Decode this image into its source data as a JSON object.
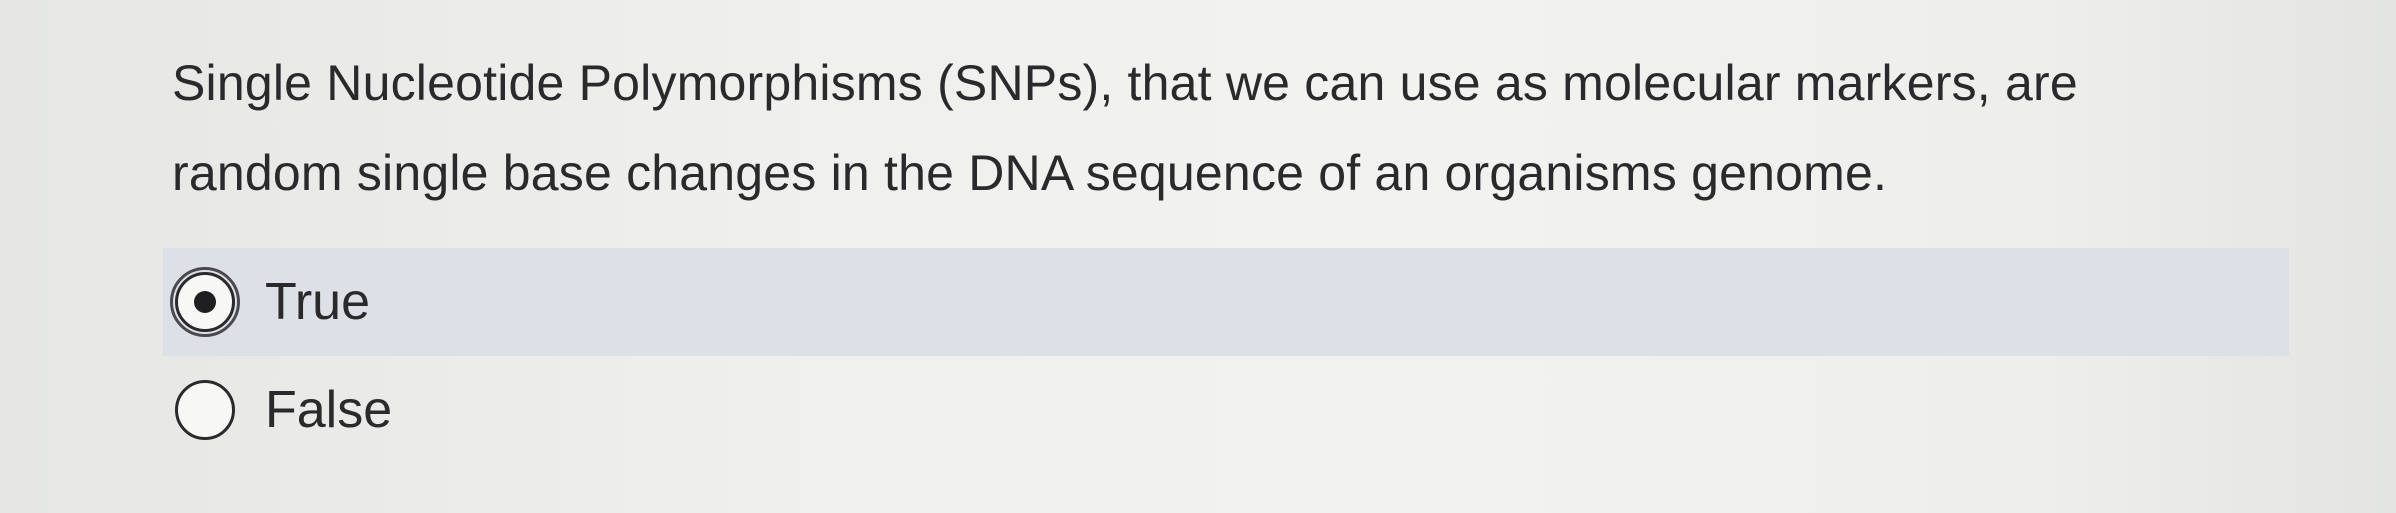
{
  "question": {
    "line1": "Single Nucleotide Polymorphisms (SNPs), that we can use as molecular markers, are",
    "line2": "random single base changes in the DNA sequence of an organisms genome."
  },
  "options": [
    {
      "label": "True",
      "selected": true
    },
    {
      "label": "False",
      "selected": false
    }
  ]
}
